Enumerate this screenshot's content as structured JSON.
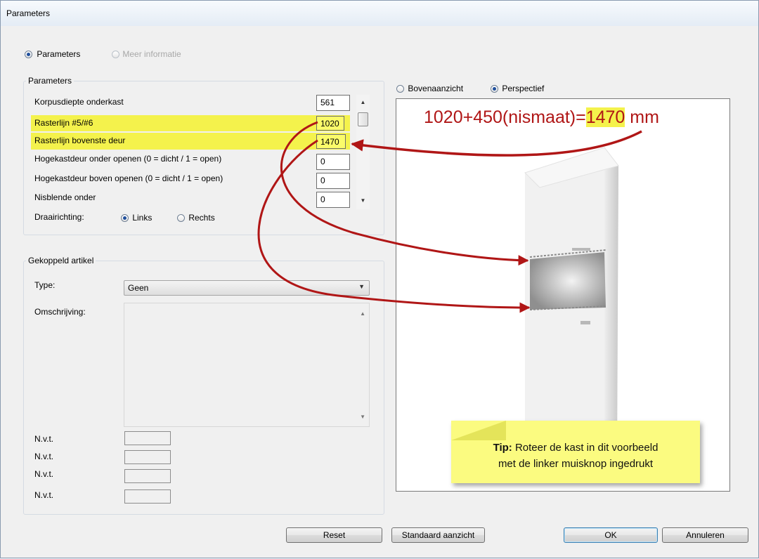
{
  "window": {
    "title": "Parameters"
  },
  "mode": {
    "parameters_label": "Parameters",
    "info_label": "Meer informatie"
  },
  "params": {
    "group_label": "Parameters",
    "rows": [
      {
        "label": "Korpusdiepte onderkast",
        "value": "561"
      },
      {
        "label": "Rasterlijn #5/#6",
        "value": "1020"
      },
      {
        "label": "Rasterlijn bovenste deur",
        "value": "1470"
      },
      {
        "label": "Hogekastdeur onder openen (0 = dicht / 1 = open)",
        "value": "0"
      },
      {
        "label": "Hogekastdeur boven openen (0 = dicht / 1 = open)",
        "value": "0"
      },
      {
        "label": "Nisblende onder",
        "value": "0"
      }
    ],
    "direction_label": "Draairichting:",
    "left_label": "Links",
    "right_label": "Rechts"
  },
  "linked": {
    "group_label": "Gekoppeld artikel",
    "type_label": "Type:",
    "type_value": "Geen",
    "desc_label": "Omschrijving:",
    "nvt": [
      "N.v.t.",
      "N.v.t.",
      "N.v.t.",
      "N.v.t."
    ]
  },
  "view": {
    "top_label": "Bovenaanzicht",
    "persp_label": "Perspectief"
  },
  "annotation": {
    "formula_prefix": "1020+450(nismaat)=",
    "formula_value": "1470",
    "formula_unit": " mm"
  },
  "tip": {
    "bold": "Tip:",
    "line1": " Roteer de kast in dit voorbeeld",
    "line2": "met de linker muisknop ingedrukt"
  },
  "buttons": {
    "reset": "Reset",
    "standard_view": "Standaard aanzicht",
    "ok": "OK",
    "cancel": "Annuleren"
  },
  "colors": {
    "highlight": "#f4f24c",
    "annotation_red": "#b01616",
    "tip_bg": "#fbfb80"
  }
}
